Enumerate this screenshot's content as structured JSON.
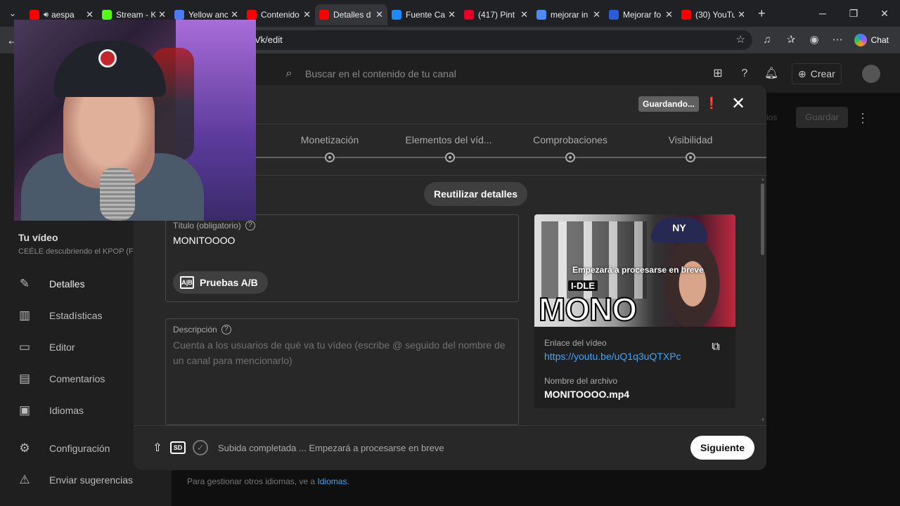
{
  "browser": {
    "tabs": [
      {
        "label": "aespa",
        "favicon_color": "#ff0000",
        "has_audio": true
      },
      {
        "label": "Stream - K",
        "favicon_color": "#53fc18"
      },
      {
        "label": "Yellow anc",
        "favicon_color": "#4c7cf3"
      },
      {
        "label": "Contenido",
        "favicon_color": "#ff0000"
      },
      {
        "label": "Detalles d",
        "favicon_color": "#ff0000",
        "active": true
      },
      {
        "label": "Fuente Ca",
        "favicon_color": "#1a8cff"
      },
      {
        "label": "(417) Pint",
        "favicon_color": "#e60023"
      },
      {
        "label": "mejorar in",
        "favicon_color": "#4c8bf5"
      },
      {
        "label": "Mejorar fo",
        "favicon_color": "#2a5cdb"
      },
      {
        "label": "(30) YouTu",
        "favicon_color": "#ff0000"
      }
    ],
    "url_suffix": "Vk/edit",
    "chat_label": "Chat"
  },
  "studio": {
    "search_placeholder": "Buscar en el contenido de tu canal",
    "create_label": "Crear",
    "save_behind": "Guardar",
    "footer_text": "Para gestionar otros idiomas, ve a",
    "footer_link": "Idiomas."
  },
  "sidebar": {
    "section_title": "Tu vídeo",
    "section_sub": "CEÉLE descubriendo el KPOP (F",
    "items": [
      {
        "label": "Detalles",
        "icon": "pencil-icon"
      },
      {
        "label": "Estadísticas",
        "icon": "chart-icon"
      },
      {
        "label": "Editor",
        "icon": "film-icon"
      },
      {
        "label": "Comentarios",
        "icon": "comment-icon"
      },
      {
        "label": "Idiomas",
        "icon": "subtitles-icon"
      },
      {
        "label": "Configuración",
        "icon": "gear-icon"
      },
      {
        "label": "Enviar sugerencias",
        "icon": "feedback-icon"
      }
    ]
  },
  "modal": {
    "saving_badge": "Guardando...",
    "steps": [
      "Monetización",
      "Elementos del víd...",
      "Comprobaciones",
      "Visibilidad"
    ],
    "reuse_button": "Reutilizar detalles",
    "title_label": "Título (obligatorio)",
    "title_value": "MONITOOOO",
    "ab_button": "Pruebas A/B",
    "description_label": "Descripción",
    "description_placeholder": "Cuenta a los usuarios de qué va tu vídeo (escribe @ seguido del nombre de un canal para mencionarlo)",
    "preview": {
      "processing_text": "Empezará a procesarse en breve",
      "thumb_brand": "I-DLE",
      "thumb_word": "MONO",
      "thumb_cap": "NY",
      "link_label": "Enlace del vídeo",
      "link_value": "https://youtu.be/uQ1q3uQTXPc",
      "file_label": "Nombre del archivo",
      "file_value": "MONITOOOO.mp4"
    },
    "upload_status": "Subida completada ... Empezará a procesarse en breve",
    "quality_badge": "SD",
    "next_button": "Siguiente"
  }
}
